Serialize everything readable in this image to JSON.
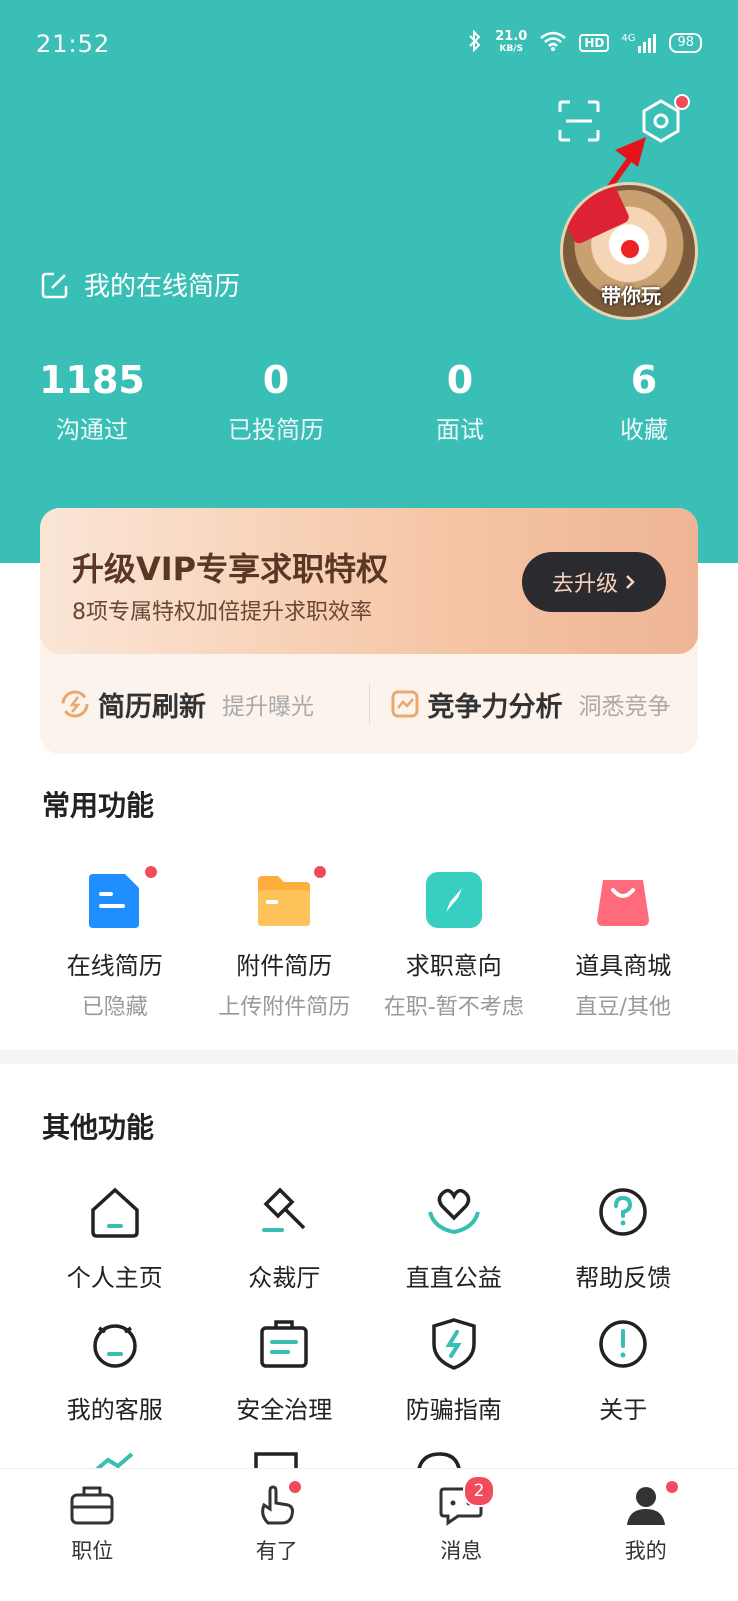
{
  "status": {
    "time": "21:52",
    "speed": "21.0",
    "speed_unit": "KB/S",
    "hd": "HD",
    "net": "4G",
    "battery": "98"
  },
  "profile": {
    "resume_link": "我的在线简历",
    "avatar_caption": "带你玩"
  },
  "stats": [
    {
      "num": "1185",
      "label": "沟通过"
    },
    {
      "num": "0",
      "label": "已投简历"
    },
    {
      "num": "0",
      "label": "面试"
    },
    {
      "num": "6",
      "label": "收藏"
    }
  ],
  "vip": {
    "title": "升级VIP专享求职特权",
    "subtitle": "8项专属特权加倍提升求职效率",
    "button": "去升级",
    "items": [
      {
        "title": "简历刷新",
        "sub": "提升曝光"
      },
      {
        "title": "竞争力分析",
        "sub": "洞悉竞争"
      }
    ]
  },
  "common": {
    "title": "常用功能",
    "items": [
      {
        "label": "在线简历",
        "sub": "已隐藏"
      },
      {
        "label": "附件简历",
        "sub": "上传附件简历"
      },
      {
        "label": "求职意向",
        "sub": "在职-暂不考虑"
      },
      {
        "label": "道具商城",
        "sub": "直豆/其他"
      }
    ]
  },
  "other": {
    "title": "其他功能",
    "row1": [
      {
        "label": "个人主页"
      },
      {
        "label": "众裁厅"
      },
      {
        "label": "直直公益"
      },
      {
        "label": "帮助反馈"
      }
    ],
    "row2": [
      {
        "label": "我的客服"
      },
      {
        "label": "安全治理"
      },
      {
        "label": "防骗指南"
      },
      {
        "label": "关于"
      }
    ]
  },
  "tabs": [
    {
      "label": "职位"
    },
    {
      "label": "有了"
    },
    {
      "label": "消息",
      "badge": "2"
    },
    {
      "label": "我的"
    }
  ],
  "colors": {
    "brand": "#3abfb6",
    "red_dot": "#f24b5b",
    "vip_dark": "#2b2a2e"
  }
}
